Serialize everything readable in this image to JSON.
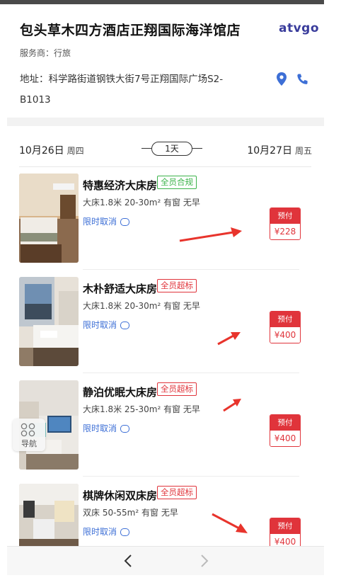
{
  "hotel": {
    "name": "包头草木四方酒店正翔国际海洋馆店",
    "brand": "atvgo",
    "provider": "服务商：行旅",
    "address": "地址：科学路街道钢铁大街7号正翔国际广场S2-B1013"
  },
  "dates": {
    "checkin": "10月26日",
    "checkin_weekday": "周四",
    "nights": "1天",
    "checkout": "10月27日",
    "checkout_weekday": "周五"
  },
  "rooms": [
    {
      "name": "特惠经济大床房",
      "tag": "全员合规",
      "tag_color": "green",
      "spec": "大床1.8米  20-30m²  有窗  无早",
      "cancel": "限时取消",
      "pay_label": "预付",
      "price": "¥228"
    },
    {
      "name": "木朴舒适大床房",
      "tag": "全员超标",
      "tag_color": "red",
      "spec": "大床1.8米  20-30m²  有窗  无早",
      "cancel": "限时取消",
      "pay_label": "预付",
      "price": "¥400"
    },
    {
      "name": "静泊优眠大床房",
      "tag": "全员超标",
      "tag_color": "red",
      "spec": "大床1.8米  25-30m²  有窗  无早",
      "cancel": "限时取消",
      "pay_label": "预付",
      "price": "¥400"
    },
    {
      "name": "棋牌休闲双床房",
      "tag": "全员超标",
      "tag_color": "red",
      "spec": "双床  50-55m²  有窗  无早",
      "cancel": "限时取消",
      "pay_label": "预付",
      "price": "¥400"
    }
  ],
  "float_nav": {
    "label": "导航",
    "icon": "grid-icon"
  },
  "colors": {
    "accent_blue": "#3d6fd6",
    "red": "#e0343b",
    "green": "#3bb34a",
    "brand": "#3a3d9c"
  }
}
